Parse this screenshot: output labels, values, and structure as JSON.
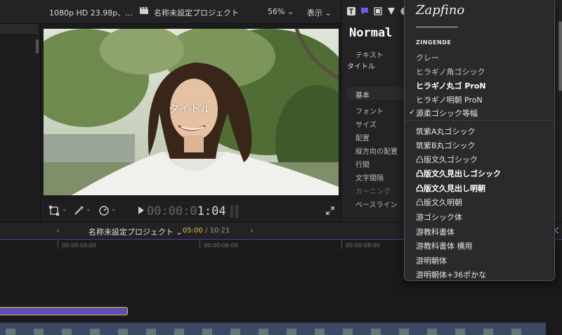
{
  "viewer": {
    "format": "1080p HD 23.98p、…",
    "project_title": "名称未設定プロジェクト",
    "zoom": "56%",
    "view_label": "表示",
    "title_overlay": "タイトル",
    "timecode_dim": "00:00:0",
    "timecode_bright": "1:04"
  },
  "inspector": {
    "style_name": "Normal",
    "text_section": "テキスト",
    "text_value": "タイトル",
    "basic_section": "基本",
    "labels": [
      "フォント",
      "サイズ",
      "配置",
      "縦方向の配置",
      "行間",
      "文字間隔",
      "カーニング",
      "ベースライン"
    ]
  },
  "font_menu": {
    "header_font": "Zapfino",
    "zingende": "ZINGENDE",
    "items": [
      "クレー",
      "ヒラギノ角ゴシック",
      "ヒラギノ丸ゴ ProN",
      "ヒラギノ明朝 ProN",
      "源柔ゴシック等幅",
      "筑紫A丸ゴシック",
      "筑紫B丸ゴシック",
      "凸版文久ゴシック",
      "凸版文久見出しゴシック",
      "凸版文久見出し明朝",
      "凸版文久明朝",
      "游ゴシック体",
      "游教科書体",
      "游教科書体 横用",
      "游明朝体",
      "游明朝体+36ポかな"
    ],
    "selected_index": 4
  },
  "timeline": {
    "project_name": "名称未設定プロジェクト",
    "current_time": "05:00",
    "separator": " / ",
    "total_time": "10:21",
    "ruler": [
      "00:00:04:00",
      "00:00:06:00",
      "00:00:08:00"
    ]
  },
  "colors": {
    "accent_purple": "#5a4fb5",
    "selection_yellow": "#e2b84a",
    "background": "#1b1b1d"
  }
}
